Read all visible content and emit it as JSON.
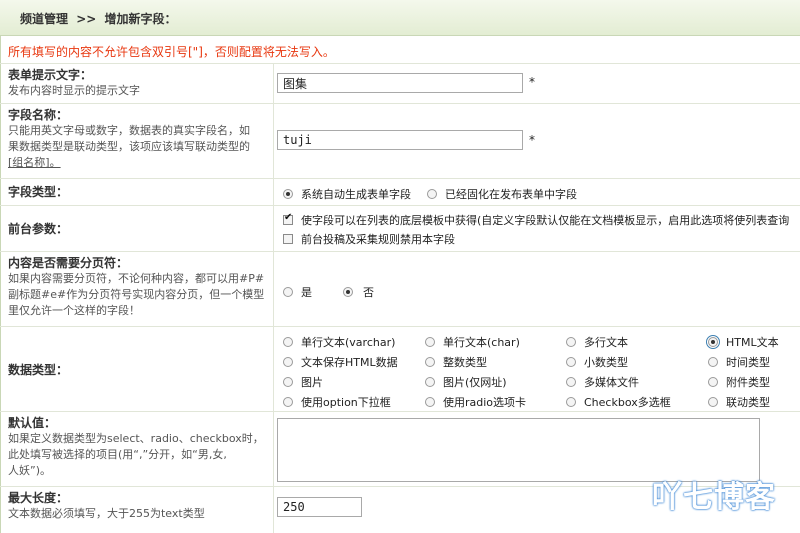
{
  "breadcrumb": {
    "section": "频道管理",
    "separator": ">>",
    "current": "增加新字段："
  },
  "warning": "所有填写的内容不允许包含双引号[\"]，否则配置将无法写入。",
  "fields": {
    "form_hint": {
      "title": "表单提示文字：",
      "desc": "发布内容时显示的提示文字",
      "value": "图集",
      "required": "*"
    },
    "field_name": {
      "title": "字段名称：",
      "desc1": "只能用英文字母或数字，数据表的真实字段名，如",
      "desc2": "果数据类型是联动类型，该项应该填写联动类型的",
      "desc3": "[组名称]。",
      "value": "tuji",
      "required": "*"
    },
    "field_type": {
      "title": "字段类型：",
      "options": [
        "系统自动生成表单字段",
        "已经固化在发布表单中字段"
      ],
      "selected": 0
    },
    "frontend": {
      "title": "前台参数：",
      "options": [
        "使字段可以在列表的底层模板中获得(自定义字段默认仅能在文档模板显示，启用此选项将使列表查询",
        "前台投稿及采集规则禁用本字段"
      ],
      "checked": [
        true,
        false
      ]
    },
    "paging": {
      "title": "内容是否需要分页符：",
      "desc1": "如果内容需要分页符，不论何种内容，都可以用#P#",
      "desc2": "副标题#e#作为分页符号实现内容分页，但一个模型",
      "desc3": "里仅允许一个这样的字段！",
      "options": [
        "是",
        "否"
      ],
      "selected": 1
    },
    "data_type": {
      "title": "数据类型：",
      "options": [
        "单行文本(varchar)",
        "单行文本(char)",
        "多行文本",
        "HTML文本",
        "文本保存HTML数据",
        "整数类型",
        "小数类型",
        "时间类型",
        "图片",
        "图片(仅网址)",
        "多媒体文件",
        "附件类型",
        "使用option下拉框",
        "使用radio选项卡",
        "Checkbox多选框",
        "联动类型"
      ],
      "selected": 3
    },
    "default_value": {
      "title": "默认值：",
      "desc1": "如果定义数据类型为select、radio、checkbox时，",
      "desc2": "此处填写被选择的项目(用“,”分开，如“男,女,",
      "desc3": "人妖”)。"
    },
    "max_length": {
      "title": "最大长度：",
      "desc": "文本数据必须填写，大于255为text类型",
      "value": "250"
    }
  },
  "watermark": "吖七博客"
}
